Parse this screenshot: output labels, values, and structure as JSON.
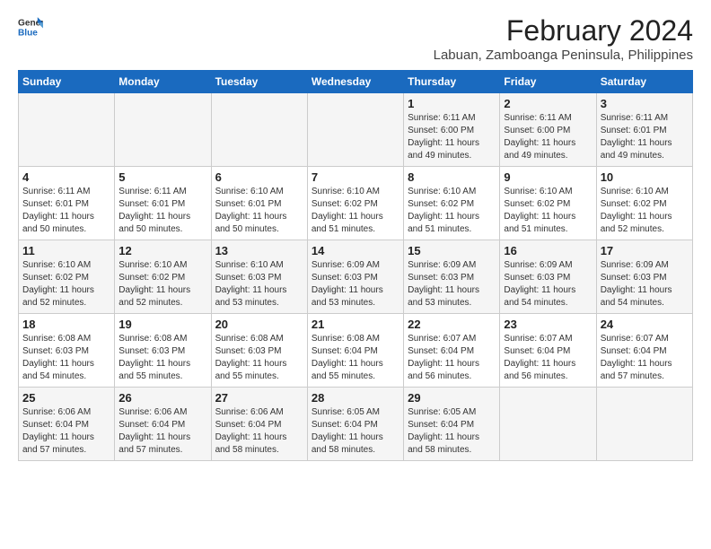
{
  "logo": {
    "line1": "General",
    "line2": "Blue"
  },
  "title": "February 2024",
  "subtitle": "Labuan, Zamboanga Peninsula, Philippines",
  "days_of_week": [
    "Sunday",
    "Monday",
    "Tuesday",
    "Wednesday",
    "Thursday",
    "Friday",
    "Saturday"
  ],
  "weeks": [
    [
      {
        "day": "",
        "info": ""
      },
      {
        "day": "",
        "info": ""
      },
      {
        "day": "",
        "info": ""
      },
      {
        "day": "",
        "info": ""
      },
      {
        "day": "1",
        "info": "Sunrise: 6:11 AM\nSunset: 6:00 PM\nDaylight: 11 hours\nand 49 minutes."
      },
      {
        "day": "2",
        "info": "Sunrise: 6:11 AM\nSunset: 6:00 PM\nDaylight: 11 hours\nand 49 minutes."
      },
      {
        "day": "3",
        "info": "Sunrise: 6:11 AM\nSunset: 6:01 PM\nDaylight: 11 hours\nand 49 minutes."
      }
    ],
    [
      {
        "day": "4",
        "info": "Sunrise: 6:11 AM\nSunset: 6:01 PM\nDaylight: 11 hours\nand 50 minutes."
      },
      {
        "day": "5",
        "info": "Sunrise: 6:11 AM\nSunset: 6:01 PM\nDaylight: 11 hours\nand 50 minutes."
      },
      {
        "day": "6",
        "info": "Sunrise: 6:10 AM\nSunset: 6:01 PM\nDaylight: 11 hours\nand 50 minutes."
      },
      {
        "day": "7",
        "info": "Sunrise: 6:10 AM\nSunset: 6:02 PM\nDaylight: 11 hours\nand 51 minutes."
      },
      {
        "day": "8",
        "info": "Sunrise: 6:10 AM\nSunset: 6:02 PM\nDaylight: 11 hours\nand 51 minutes."
      },
      {
        "day": "9",
        "info": "Sunrise: 6:10 AM\nSunset: 6:02 PM\nDaylight: 11 hours\nand 51 minutes."
      },
      {
        "day": "10",
        "info": "Sunrise: 6:10 AM\nSunset: 6:02 PM\nDaylight: 11 hours\nand 52 minutes."
      }
    ],
    [
      {
        "day": "11",
        "info": "Sunrise: 6:10 AM\nSunset: 6:02 PM\nDaylight: 11 hours\nand 52 minutes."
      },
      {
        "day": "12",
        "info": "Sunrise: 6:10 AM\nSunset: 6:02 PM\nDaylight: 11 hours\nand 52 minutes."
      },
      {
        "day": "13",
        "info": "Sunrise: 6:10 AM\nSunset: 6:03 PM\nDaylight: 11 hours\nand 53 minutes."
      },
      {
        "day": "14",
        "info": "Sunrise: 6:09 AM\nSunset: 6:03 PM\nDaylight: 11 hours\nand 53 minutes."
      },
      {
        "day": "15",
        "info": "Sunrise: 6:09 AM\nSunset: 6:03 PM\nDaylight: 11 hours\nand 53 minutes."
      },
      {
        "day": "16",
        "info": "Sunrise: 6:09 AM\nSunset: 6:03 PM\nDaylight: 11 hours\nand 54 minutes."
      },
      {
        "day": "17",
        "info": "Sunrise: 6:09 AM\nSunset: 6:03 PM\nDaylight: 11 hours\nand 54 minutes."
      }
    ],
    [
      {
        "day": "18",
        "info": "Sunrise: 6:08 AM\nSunset: 6:03 PM\nDaylight: 11 hours\nand 54 minutes."
      },
      {
        "day": "19",
        "info": "Sunrise: 6:08 AM\nSunset: 6:03 PM\nDaylight: 11 hours\nand 55 minutes."
      },
      {
        "day": "20",
        "info": "Sunrise: 6:08 AM\nSunset: 6:03 PM\nDaylight: 11 hours\nand 55 minutes."
      },
      {
        "day": "21",
        "info": "Sunrise: 6:08 AM\nSunset: 6:04 PM\nDaylight: 11 hours\nand 55 minutes."
      },
      {
        "day": "22",
        "info": "Sunrise: 6:07 AM\nSunset: 6:04 PM\nDaylight: 11 hours\nand 56 minutes."
      },
      {
        "day": "23",
        "info": "Sunrise: 6:07 AM\nSunset: 6:04 PM\nDaylight: 11 hours\nand 56 minutes."
      },
      {
        "day": "24",
        "info": "Sunrise: 6:07 AM\nSunset: 6:04 PM\nDaylight: 11 hours\nand 57 minutes."
      }
    ],
    [
      {
        "day": "25",
        "info": "Sunrise: 6:06 AM\nSunset: 6:04 PM\nDaylight: 11 hours\nand 57 minutes."
      },
      {
        "day": "26",
        "info": "Sunrise: 6:06 AM\nSunset: 6:04 PM\nDaylight: 11 hours\nand 57 minutes."
      },
      {
        "day": "27",
        "info": "Sunrise: 6:06 AM\nSunset: 6:04 PM\nDaylight: 11 hours\nand 58 minutes."
      },
      {
        "day": "28",
        "info": "Sunrise: 6:05 AM\nSunset: 6:04 PM\nDaylight: 11 hours\nand 58 minutes."
      },
      {
        "day": "29",
        "info": "Sunrise: 6:05 AM\nSunset: 6:04 PM\nDaylight: 11 hours\nand 58 minutes."
      },
      {
        "day": "",
        "info": ""
      },
      {
        "day": "",
        "info": ""
      }
    ]
  ]
}
